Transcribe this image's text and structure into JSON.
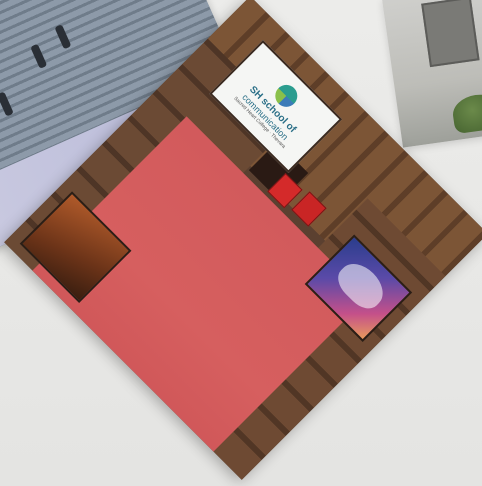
{
  "photo": {
    "sign_line1": "SH school of",
    "sign_line2": "communication",
    "sign_line3": "Sacred Heart College · Thevara",
    "floor_color": "#d65f5f",
    "subject": "hallway-with-red-floor"
  }
}
